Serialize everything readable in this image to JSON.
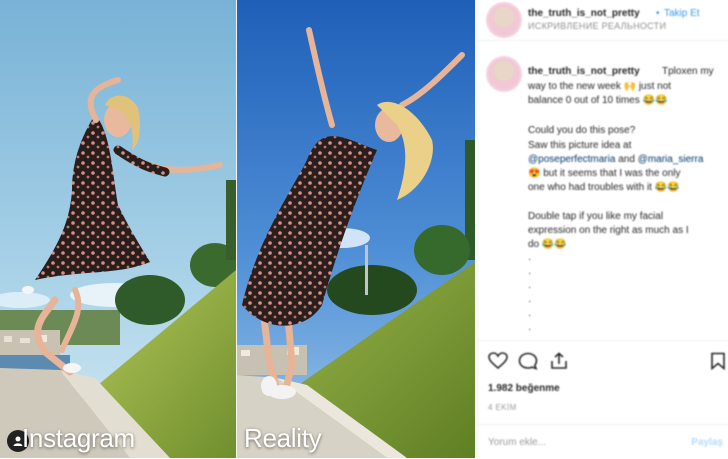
{
  "photos": {
    "left_caption": "Instagram",
    "right_caption": "Reality"
  },
  "post": {
    "username": "the_truth_is_not_pretty",
    "follow_separator": "•",
    "follow_label": "Takip Et",
    "location": "ИСКРИВЛЕНИЕ РЕАЛЬНОСТИ",
    "caption_username": "the_truth_is_not_pretty",
    "caption_lines": [
      "Tploxen my",
      "way to the new week 🙌 just not",
      "balance 0 out of 10 times 😂😂",
      "Could you do this pose?",
      "Saw this picture idea at",
      "@poseperfectmaria and @maria_sierra",
      "😍 but it seems that I was the only",
      "one who had troubles with it 😂😂",
      "Double tap if you like my facial",
      "expression on the right as much as I",
      "do 😂😂"
    ],
    "mention_1": "@poseperfectmaria",
    "mention_2": "@maria_sierra",
    "dots": [
      "·",
      "·",
      "·",
      "·",
      "·",
      "·"
    ],
    "likes": "1.982 beğenme",
    "date": "4 EKİM",
    "comment_placeholder": "Yorum ekle...",
    "post_label": "Paylaş"
  },
  "icons": [
    "heart-icon",
    "comment-icon",
    "share-icon",
    "bookmark-icon",
    "user-icon"
  ],
  "colors": {
    "link_blue": "#3897f0",
    "text": "#262626",
    "muted": "#8e8e8e",
    "story_ring": "#f6d0dd"
  }
}
